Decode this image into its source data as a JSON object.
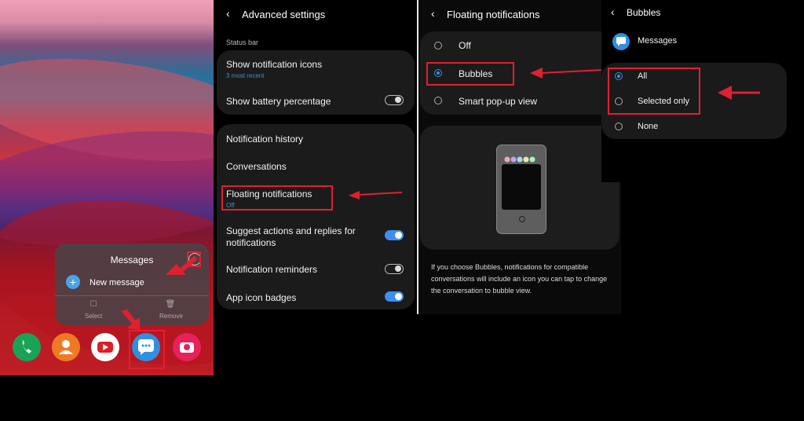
{
  "home": {
    "popup_title": "Messages",
    "new_message_label": "New message",
    "select_label": "Select",
    "remove_label": "Remove"
  },
  "advanced": {
    "title": "Advanced settings",
    "section_status_bar": "Status bar",
    "show_notification_icons": "Show notification icons",
    "show_notification_icons_sub": "3 most recent",
    "show_battery_percentage": "Show battery percentage",
    "notification_history": "Notification history",
    "conversations": "Conversations",
    "floating_notifications": "Floating notifications",
    "floating_notifications_sub": "Off",
    "suggest_actions": "Suggest actions and replies for notifications",
    "notification_reminders": "Notification reminders",
    "app_icon_badges": "App icon badges"
  },
  "floating": {
    "title": "Floating notifications",
    "option_off": "Off",
    "option_bubbles": "Bubbles",
    "option_smart": "Smart pop-up view",
    "description": "If you choose Bubbles, notifications for compatible conversations will include an icon you can tap to change the conversation to bubble view."
  },
  "bubbles": {
    "title": "Bubbles",
    "app_name": "Messages",
    "option_all": "All",
    "option_selected": "Selected only",
    "option_none": "None"
  },
  "icons": [
    "phone-icon",
    "contacts-icon",
    "youtube-icon",
    "messages-icon",
    "camera-icon",
    "info-icon",
    "plus-icon",
    "back-arrow-icon",
    "radio-icon",
    "toggle-icon",
    "annotation-arrow-icon"
  ],
  "colors": {
    "accent_blue": "#3c8ff0",
    "annotation_red": "#e02030",
    "card_bg": "#1b1b1b"
  }
}
